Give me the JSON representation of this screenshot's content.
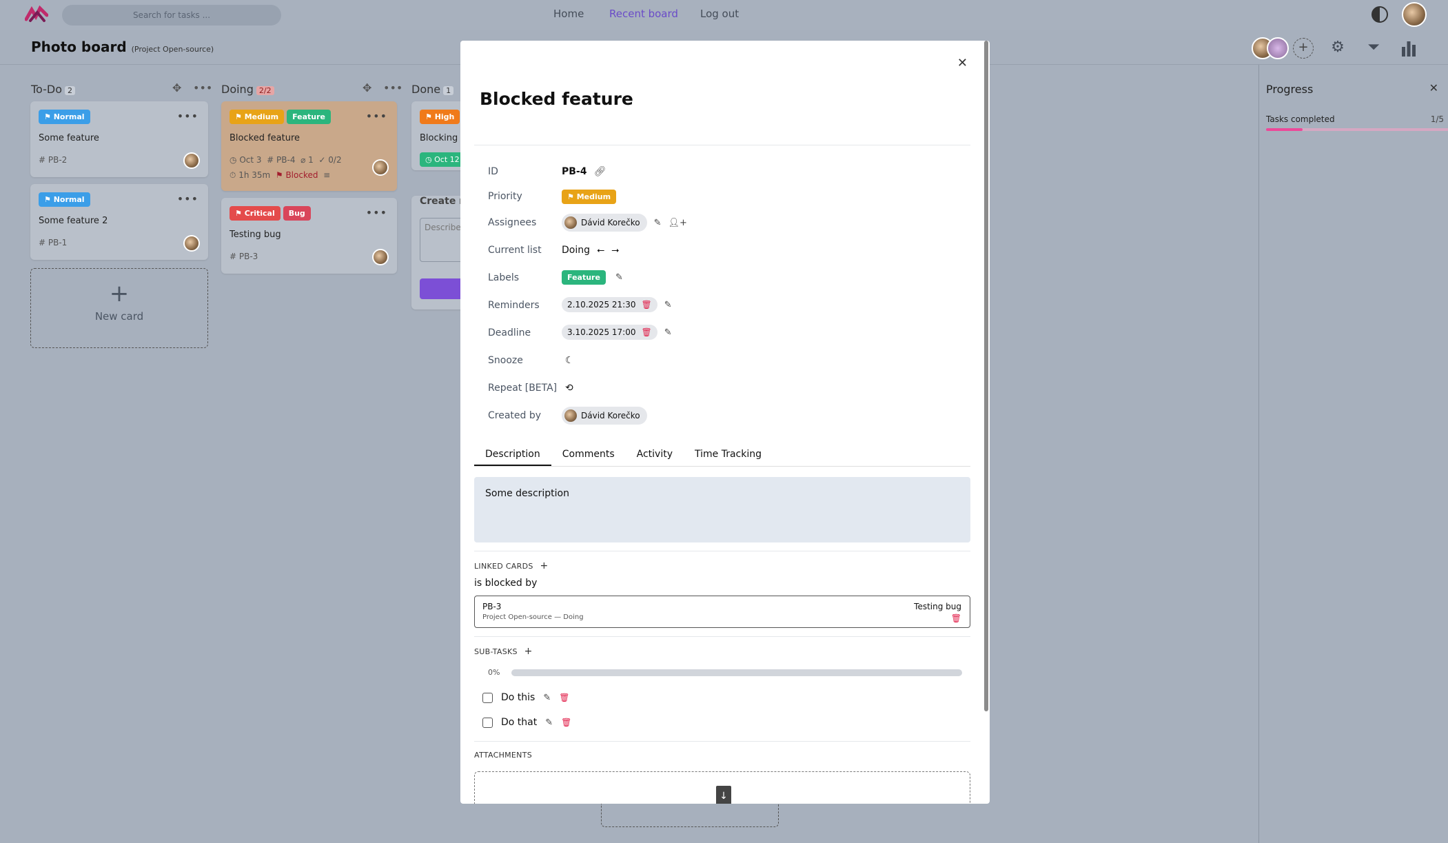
{
  "topbar": {
    "search_placeholder": "Search for tasks ...",
    "nav": [
      "Home",
      "Recent board",
      "Log out"
    ]
  },
  "board": {
    "title": "Photo board",
    "project": "(Project Open-source)"
  },
  "columns": [
    {
      "name": "To-Do",
      "count": "2"
    },
    {
      "name": "Doing",
      "count": "2/2"
    },
    {
      "name": "Done",
      "count": "1"
    }
  ],
  "cards": {
    "todo1": {
      "priority": "Normal",
      "title": "Some feature",
      "id": "PB-2"
    },
    "todo2": {
      "priority": "Normal",
      "title": "Some feature 2",
      "id": "PB-1"
    },
    "doing1": {
      "priority": "Medium",
      "label": "Feature",
      "title": "Blocked feature",
      "date": "Oct 3",
      "id": "PB-4",
      "attach": "1",
      "check": "0/2",
      "time": "1h 35m",
      "blocked": "Blocked"
    },
    "doing2": {
      "priority": "Critical",
      "label": "Bug",
      "title": "Testing bug",
      "id": "PB-3"
    },
    "done1": {
      "priority": "High",
      "title": "Blocking fe",
      "date": "Oct 12"
    },
    "create_label": "Create ne",
    "describe_placeholder": "Describe"
  },
  "new_card_label": "New card",
  "progress": {
    "title": "Progress",
    "tasks_label": "Tasks completed",
    "tasks_value": "1/5",
    "fraction": 0.2
  },
  "modal": {
    "title": "Blocked feature",
    "rows": {
      "id_label": "ID",
      "id_value": "PB-4",
      "priority_label": "Priority",
      "priority_value": "Medium",
      "assignees_label": "Assignees",
      "assignee": "Dávid Korečko",
      "list_label": "Current list",
      "list_value": "Doing",
      "labels_label": "Labels",
      "label_value": "Feature",
      "reminders_label": "Reminders",
      "reminder_value": "2.10.2025 21:30",
      "deadline_label": "Deadline",
      "deadline_value": "3.10.2025 17:00",
      "snooze_label": "Snooze",
      "repeat_label": "Repeat [BETA]",
      "created_label": "Created by",
      "created_value": "Dávid Korečko"
    },
    "tabs": [
      "Description",
      "Comments",
      "Activity",
      "Time Tracking"
    ],
    "description": "Some description",
    "linked_title": "LINKED CARDS",
    "relation": "is blocked by",
    "linked_card": {
      "id": "PB-3",
      "sub": "Project Open-source — Doing",
      "title": "Testing bug"
    },
    "subtasks_title": "SUB-TASKS",
    "subtasks_percent": "0%",
    "subtasks_fraction": 0,
    "subtasks": [
      "Do this",
      "Do that"
    ],
    "attachments_title": "ATTACHMENTS"
  },
  "colors": {
    "normal": "#3b9ee8",
    "medium": "#e8a317",
    "high": "#f07a1a",
    "critical": "#e44b4b",
    "feature": "#2bb57d",
    "bug": "#d9455a",
    "accent": "#6a4bc8",
    "progress": "#ec4899"
  }
}
